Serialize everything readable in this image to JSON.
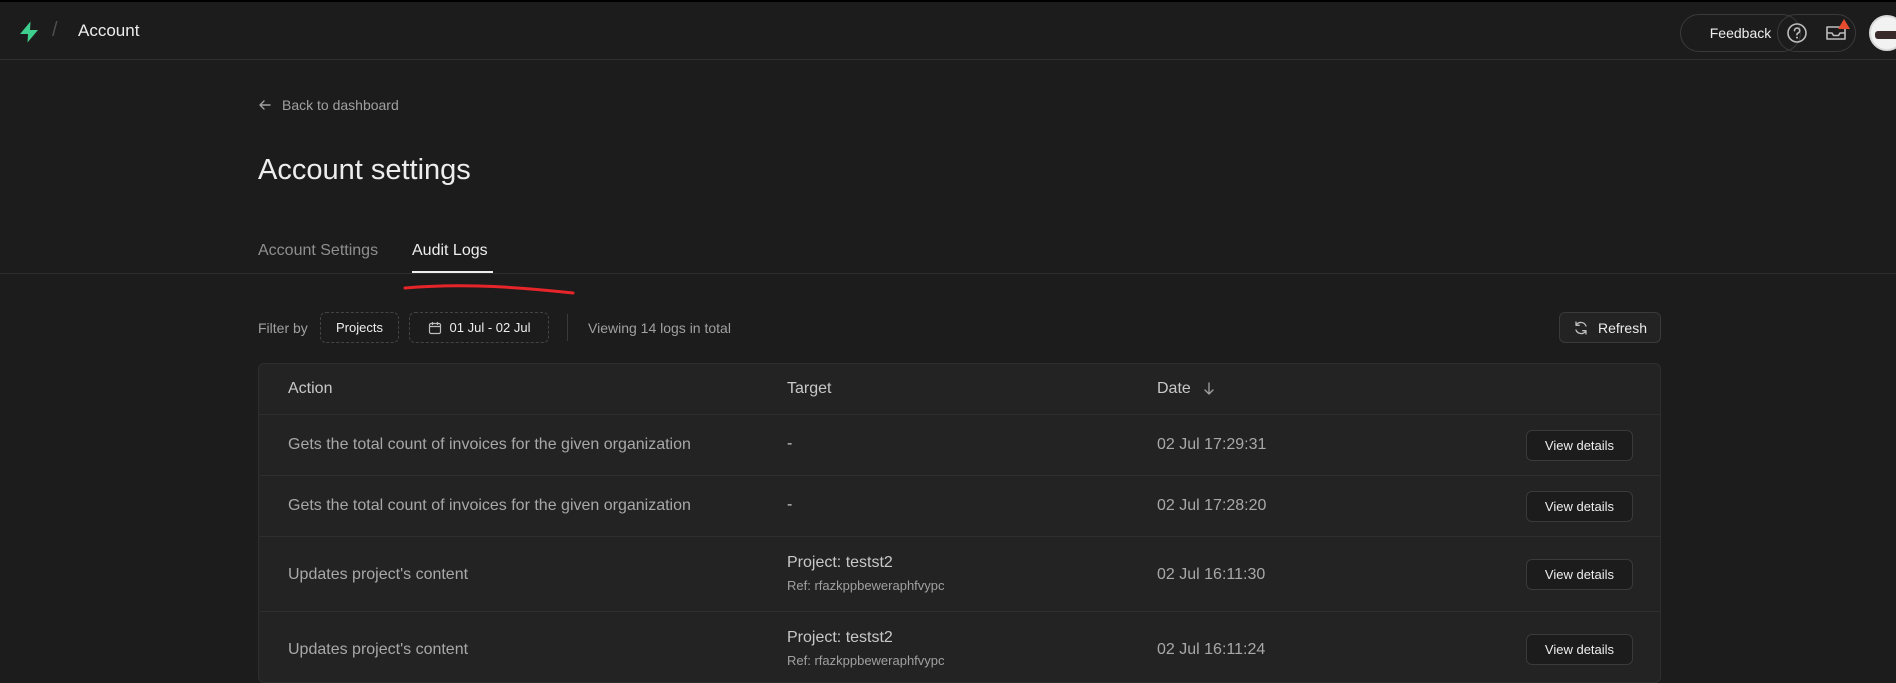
{
  "header": {
    "crumb_separator": "/",
    "breadcrumb": "Account",
    "feedback_label": "Feedback",
    "icons": [
      "supabase-logo",
      "help-icon",
      "inbox-icon",
      "avatar"
    ],
    "notification_color": "#e54d2e"
  },
  "page": {
    "back_label": "Back to dashboard",
    "title": "Account settings",
    "tabs": [
      {
        "label": "Account Settings",
        "active": false
      },
      {
        "label": "Audit Logs",
        "active": true
      }
    ]
  },
  "filters": {
    "label": "Filter by",
    "projects_label": "Projects",
    "date_range": "01 Jul - 02 Jul",
    "viewing_text": "Viewing 14 logs in total",
    "refresh_label": "Refresh"
  },
  "table": {
    "columns": [
      "Action",
      "Target",
      "Date"
    ],
    "rows": [
      {
        "action": "Gets the total count of invoices for the given organization",
        "target": "-",
        "ref": "",
        "date": "02 Jul 17:29:31",
        "button": "View details"
      },
      {
        "action": "Gets the total count of invoices for the given organization",
        "target": "-",
        "ref": "",
        "date": "02 Jul 17:28:20",
        "button": "View details"
      },
      {
        "action": "Updates project's content",
        "target": "Project: testst2",
        "ref": "Ref: rfazkppbeweraphfvypc",
        "date": "02 Jul 16:11:30",
        "button": "View details"
      },
      {
        "action": "Updates project's content",
        "target": "Project: testst2",
        "ref": "Ref: rfazkppbeweraphfvypc",
        "date": "02 Jul 16:11:24",
        "button": "View details"
      }
    ]
  },
  "colors": {
    "background": "#1c1c1c",
    "brand": "#3ecf8e",
    "annotation": "#e5252a"
  }
}
